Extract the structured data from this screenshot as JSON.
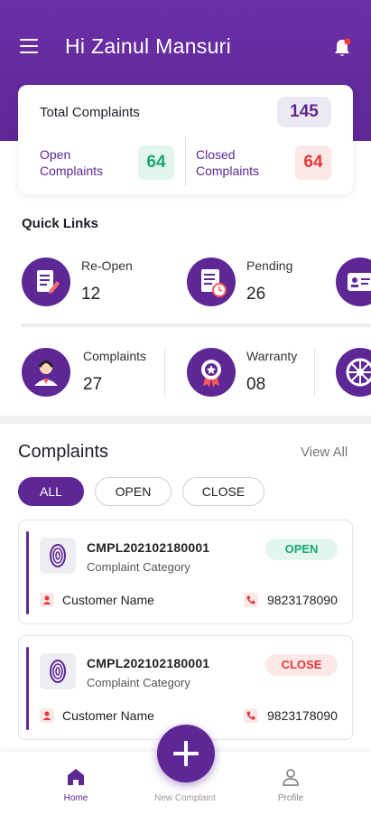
{
  "header": {
    "greeting": "Hi Zainul Mansuri",
    "menu_icon": "hamburger-menu-icon",
    "notification_icon": "bell-icon"
  },
  "summary": {
    "total_label": "Total Complaints",
    "total_value": "145",
    "open_label_1": "Open",
    "open_label_2": "Complaints",
    "open_value": "64",
    "closed_label_1": "Closed",
    "closed_label_2": "Complaints",
    "closed_value": "64"
  },
  "quick_links": {
    "title": "Quick Links",
    "items": [
      {
        "label": "Re-Open",
        "count": "12",
        "icon": "reopen-document-icon"
      },
      {
        "label": "Pending",
        "count": "26",
        "icon": "pending-clock-document-icon"
      },
      {
        "label": "",
        "count": "",
        "icon": "id-card-icon"
      },
      {
        "label": "Complaints",
        "count": "27",
        "icon": "support-agent-icon"
      },
      {
        "label": "Warranty",
        "count": "08",
        "icon": "warranty-badge-icon"
      },
      {
        "label": "",
        "count": "",
        "icon": "wheel-icon"
      }
    ]
  },
  "complaints": {
    "title": "Complaints",
    "view_all": "View All",
    "filters": [
      "ALL",
      "OPEN",
      "CLOSE"
    ],
    "items": [
      {
        "id": "CMPL202102180001",
        "category": "Complaint Category",
        "status": "OPEN",
        "customer": "Customer Name",
        "phone": "9823178090"
      },
      {
        "id": "CMPL202102180001",
        "category": "Complaint Category",
        "status": "CLOSE",
        "customer": "Customer Name",
        "phone": "9823178090"
      }
    ]
  },
  "bottom_nav": {
    "home": "Home",
    "new_complaint": "New Complaint",
    "profile": "Profile"
  },
  "colors": {
    "primary": "#5e2796",
    "open_green": "#1aa86b",
    "close_red": "#e53935"
  }
}
